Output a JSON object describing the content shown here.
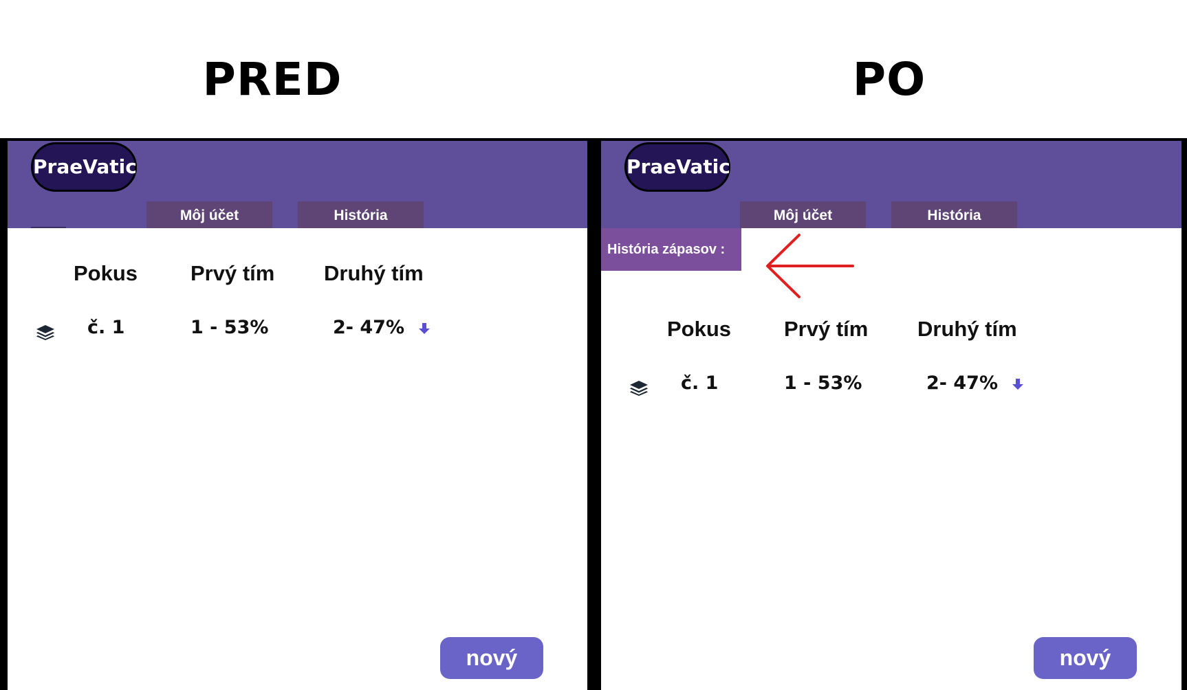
{
  "headings": {
    "before": "PRED",
    "after": "PO"
  },
  "brand": "PraeVatic",
  "nav": {
    "account": "Môj účet",
    "history": "História"
  },
  "section_label": "História zápasov :",
  "table": {
    "columns": [
      "Pokus",
      "Prvý tím",
      "Druhý tím"
    ],
    "rows": [
      {
        "attempt": "č. 1",
        "team1": "1 - 53%",
        "team2": "2- 47%"
      }
    ]
  },
  "new_button": "nový",
  "icons": {
    "row": "layers-icon",
    "trend": "arrow-down-icon",
    "annotation": "red-arrow-left-icon"
  },
  "colors": {
    "header": "#5f4f9a",
    "logo": "#231556",
    "nav_tab": "#5e4575",
    "section_label": "#7b4f9c",
    "button": "#6a64c8",
    "arrow_down": "#5b4fd1",
    "annotation": "#e02020"
  }
}
